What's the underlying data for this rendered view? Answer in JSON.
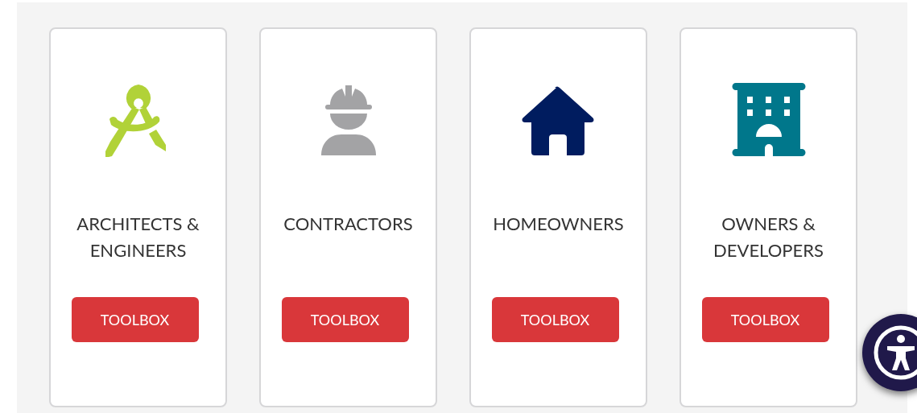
{
  "cards": [
    {
      "title": "ARCHITECTS & ENGINEERS",
      "color": "#b1d238",
      "button": "TOOLBOX"
    },
    {
      "title": "CONTRACTORS",
      "color": "#a3a3a5",
      "button": "TOOLBOX"
    },
    {
      "title": "HOMEOWNERS",
      "color": "#001c5f",
      "button": "TOOLBOX"
    },
    {
      "title": "OWNERS & DEVELOPERS",
      "color": "#00778b",
      "button": "TOOLBOX"
    }
  ]
}
